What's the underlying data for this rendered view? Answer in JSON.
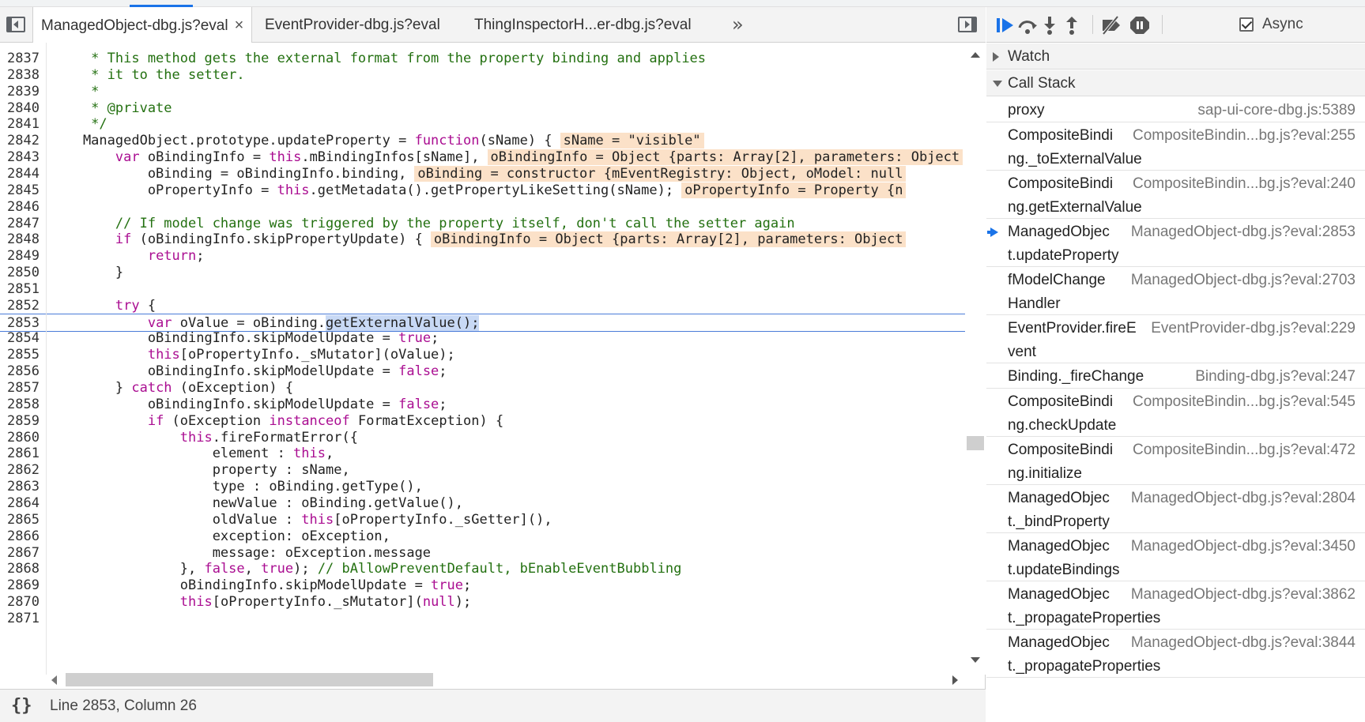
{
  "editor": {
    "tabs": [
      {
        "label": "ManagedObject-dbg.js?eval",
        "active": true
      },
      {
        "label": "EventProvider-dbg.js?eval",
        "active": false
      },
      {
        "label": "ThingInspectorH...er-dbg.js?eval",
        "active": false
      }
    ],
    "close_glyph": "×",
    "more_glyph": "»",
    "current_line": 2853,
    "lines": [
      {
        "n": "2837",
        "parts": [
          {
            "t": "cm",
            "v": "     * This method gets the external format from the property binding and applies"
          }
        ]
      },
      {
        "n": "2838",
        "parts": [
          {
            "t": "cm",
            "v": "     * it to the setter."
          }
        ]
      },
      {
        "n": "2839",
        "parts": [
          {
            "t": "cm",
            "v": "     *"
          }
        ]
      },
      {
        "n": "2840",
        "parts": [
          {
            "t": "cm",
            "v": "     * @private"
          }
        ]
      },
      {
        "n": "2841",
        "parts": [
          {
            "t": "cm",
            "v": "     */"
          }
        ]
      },
      {
        "n": "2842",
        "parts": [
          {
            "t": "",
            "v": "    ManagedObject.prototype.updateProperty = "
          },
          {
            "t": "kw",
            "v": "function"
          },
          {
            "t": "",
            "v": "(sName) {"
          },
          {
            "t": "inl",
            "v": "sName = \"visible\""
          }
        ]
      },
      {
        "n": "2843",
        "parts": [
          {
            "t": "",
            "v": "        "
          },
          {
            "t": "kw",
            "v": "var"
          },
          {
            "t": "",
            "v": " oBindingInfo = "
          },
          {
            "t": "kw",
            "v": "this"
          },
          {
            "t": "",
            "v": ".mBindingInfos[sName],"
          },
          {
            "t": "inl",
            "v": "oBindingInfo = Object {parts: Array[2], parameters: Object"
          }
        ]
      },
      {
        "n": "2844",
        "parts": [
          {
            "t": "",
            "v": "            oBinding = oBindingInfo.binding,"
          },
          {
            "t": "inl",
            "v": "oBinding = constructor {mEventRegistry: Object, oModel: null"
          }
        ]
      },
      {
        "n": "2845",
        "parts": [
          {
            "t": "",
            "v": "            oPropertyInfo = "
          },
          {
            "t": "kw",
            "v": "this"
          },
          {
            "t": "",
            "v": ".getMetadata().getPropertyLikeSetting(sName);"
          },
          {
            "t": "inl",
            "v": "oPropertyInfo = Property {n"
          }
        ]
      },
      {
        "n": "2846",
        "parts": [
          {
            "t": "",
            "v": ""
          }
        ]
      },
      {
        "n": "2847",
        "parts": [
          {
            "t": "cm",
            "v": "        // If model change was triggered by the property itself, don't call the setter again"
          }
        ]
      },
      {
        "n": "2848",
        "parts": [
          {
            "t": "",
            "v": "        "
          },
          {
            "t": "kw",
            "v": "if"
          },
          {
            "t": "",
            "v": " (oBindingInfo.skipPropertyUpdate) {"
          },
          {
            "t": "inl",
            "v": "oBindingInfo = Object {parts: Array[2], parameters: Object"
          }
        ]
      },
      {
        "n": "2849",
        "parts": [
          {
            "t": "",
            "v": "            "
          },
          {
            "t": "kw",
            "v": "return"
          },
          {
            "t": "",
            "v": ";"
          }
        ]
      },
      {
        "n": "2850",
        "parts": [
          {
            "t": "",
            "v": "        }"
          }
        ]
      },
      {
        "n": "2851",
        "parts": [
          {
            "t": "",
            "v": ""
          }
        ]
      },
      {
        "n": "2852",
        "parts": [
          {
            "t": "",
            "v": "        "
          },
          {
            "t": "kw",
            "v": "try"
          },
          {
            "t": "",
            "v": " {"
          }
        ]
      },
      {
        "n": "2853",
        "parts": [
          {
            "t": "",
            "v": "            "
          },
          {
            "t": "kw",
            "v": "var"
          },
          {
            "t": "",
            "v": " oValue = oBinding."
          },
          {
            "t": "sel",
            "v": "getExternalValue();"
          }
        ]
      },
      {
        "n": "2854",
        "parts": [
          {
            "t": "",
            "v": "            oBindingInfo.skipModelUpdate = "
          },
          {
            "t": "kw",
            "v": "true"
          },
          {
            "t": "",
            "v": ";"
          }
        ]
      },
      {
        "n": "2855",
        "parts": [
          {
            "t": "",
            "v": "            "
          },
          {
            "t": "kw",
            "v": "this"
          },
          {
            "t": "",
            "v": "[oPropertyInfo._sMutator](oValue);"
          }
        ]
      },
      {
        "n": "2856",
        "parts": [
          {
            "t": "",
            "v": "            oBindingInfo.skipModelUpdate = "
          },
          {
            "t": "kw",
            "v": "false"
          },
          {
            "t": "",
            "v": ";"
          }
        ]
      },
      {
        "n": "2857",
        "parts": [
          {
            "t": "",
            "v": "        } "
          },
          {
            "t": "kw",
            "v": "catch"
          },
          {
            "t": "",
            "v": " (oException) {"
          }
        ]
      },
      {
        "n": "2858",
        "parts": [
          {
            "t": "",
            "v": "            oBindingInfo.skipModelUpdate = "
          },
          {
            "t": "kw",
            "v": "false"
          },
          {
            "t": "",
            "v": ";"
          }
        ]
      },
      {
        "n": "2859",
        "parts": [
          {
            "t": "",
            "v": "            "
          },
          {
            "t": "kw",
            "v": "if"
          },
          {
            "t": "",
            "v": " (oException "
          },
          {
            "t": "kw",
            "v": "instanceof"
          },
          {
            "t": "",
            "v": " FormatException) {"
          }
        ]
      },
      {
        "n": "2860",
        "parts": [
          {
            "t": "",
            "v": "                "
          },
          {
            "t": "kw",
            "v": "this"
          },
          {
            "t": "",
            "v": ".fireFormatError({"
          }
        ]
      },
      {
        "n": "2861",
        "parts": [
          {
            "t": "",
            "v": "                    element : "
          },
          {
            "t": "kw",
            "v": "this"
          },
          {
            "t": "",
            "v": ","
          }
        ]
      },
      {
        "n": "2862",
        "parts": [
          {
            "t": "",
            "v": "                    property : sName,"
          }
        ]
      },
      {
        "n": "2863",
        "parts": [
          {
            "t": "",
            "v": "                    type : oBinding.getType(),"
          }
        ]
      },
      {
        "n": "2864",
        "parts": [
          {
            "t": "",
            "v": "                    newValue : oBinding.getValue(),"
          }
        ]
      },
      {
        "n": "2865",
        "parts": [
          {
            "t": "",
            "v": "                    oldValue : "
          },
          {
            "t": "kw",
            "v": "this"
          },
          {
            "t": "",
            "v": "[oPropertyInfo._sGetter](),"
          }
        ]
      },
      {
        "n": "2866",
        "parts": [
          {
            "t": "",
            "v": "                    exception: oException,"
          }
        ]
      },
      {
        "n": "2867",
        "parts": [
          {
            "t": "",
            "v": "                    message: oException.message"
          }
        ]
      },
      {
        "n": "2868",
        "parts": [
          {
            "t": "",
            "v": "                }, "
          },
          {
            "t": "kw",
            "v": "false"
          },
          {
            "t": "",
            "v": ", "
          },
          {
            "t": "kw",
            "v": "true"
          },
          {
            "t": "",
            "v": "); "
          },
          {
            "t": "cm",
            "v": "// bAllowPreventDefault, bEnableEventBubbling"
          }
        ]
      },
      {
        "n": "2869",
        "parts": [
          {
            "t": "",
            "v": "                oBindingInfo.skipModelUpdate = "
          },
          {
            "t": "kw",
            "v": "true"
          },
          {
            "t": "",
            "v": ";"
          }
        ]
      },
      {
        "n": "2870",
        "parts": [
          {
            "t": "",
            "v": "                "
          },
          {
            "t": "kw",
            "v": "this"
          },
          {
            "t": "",
            "v": "[oPropertyInfo._sMutator]("
          },
          {
            "t": "kw",
            "v": "null"
          },
          {
            "t": "",
            "v": ");"
          }
        ]
      },
      {
        "n": "2871",
        "parts": [
          {
            "t": "",
            "v": ""
          }
        ]
      }
    ]
  },
  "status": {
    "braces": "{}",
    "position": "Line 2853, Column 26"
  },
  "debugger": {
    "async_label": "Async",
    "async_checked": true,
    "sections": {
      "watch": "Watch",
      "call_stack": "Call Stack"
    },
    "frames": [
      {
        "name1": "proxy",
        "name2": "",
        "location": "sap-ui-core-dbg.js:5389",
        "current": false
      },
      {
        "name1": "CompositeBindi",
        "name2": "ng._toExternalValue",
        "location": "CompositeBindin...bg.js?eval:255",
        "current": false
      },
      {
        "name1": "CompositeBindi",
        "name2": "ng.getExternalValue",
        "location": "CompositeBindin...bg.js?eval:240",
        "current": false
      },
      {
        "name1": "ManagedObjec",
        "name2": "t.updateProperty",
        "location": "ManagedObject-dbg.js?eval:2853",
        "current": true
      },
      {
        "name1": "fModelChange",
        "name2": "Handler",
        "location": "ManagedObject-dbg.js?eval:2703",
        "current": false
      },
      {
        "name1": "EventProvider.fireE",
        "name2": "vent",
        "location": "EventProvider-dbg.js?eval:229",
        "current": false
      },
      {
        "name1": "Binding._fireChange",
        "name2": "",
        "location": "Binding-dbg.js?eval:247",
        "current": false
      },
      {
        "name1": "CompositeBindi",
        "name2": "ng.checkUpdate",
        "location": "CompositeBindin...bg.js?eval:545",
        "current": false
      },
      {
        "name1": "CompositeBindi",
        "name2": "ng.initialize",
        "location": "CompositeBindin...bg.js?eval:472",
        "current": false
      },
      {
        "name1": "ManagedObjec",
        "name2": "t._bindProperty",
        "location": "ManagedObject-dbg.js?eval:2804",
        "current": false
      },
      {
        "name1": "ManagedObjec",
        "name2": "t.updateBindings",
        "location": "ManagedObject-dbg.js?eval:3450",
        "current": false
      },
      {
        "name1": "ManagedObjec",
        "name2": "t._propagateProperties",
        "location": "ManagedObject-dbg.js?eval:3862",
        "current": false
      },
      {
        "name1": "ManagedObjec",
        "name2": "t._propagateProperties",
        "location": "ManagedObject-dbg.js?eval:3844",
        "current": false
      }
    ]
  },
  "colors": {
    "keyword": "#aa0d91",
    "comment": "#237010",
    "inline_value_bg": "#fbe1c8",
    "selection_bg": "#c8d9f5",
    "accent": "#1a73e8"
  }
}
